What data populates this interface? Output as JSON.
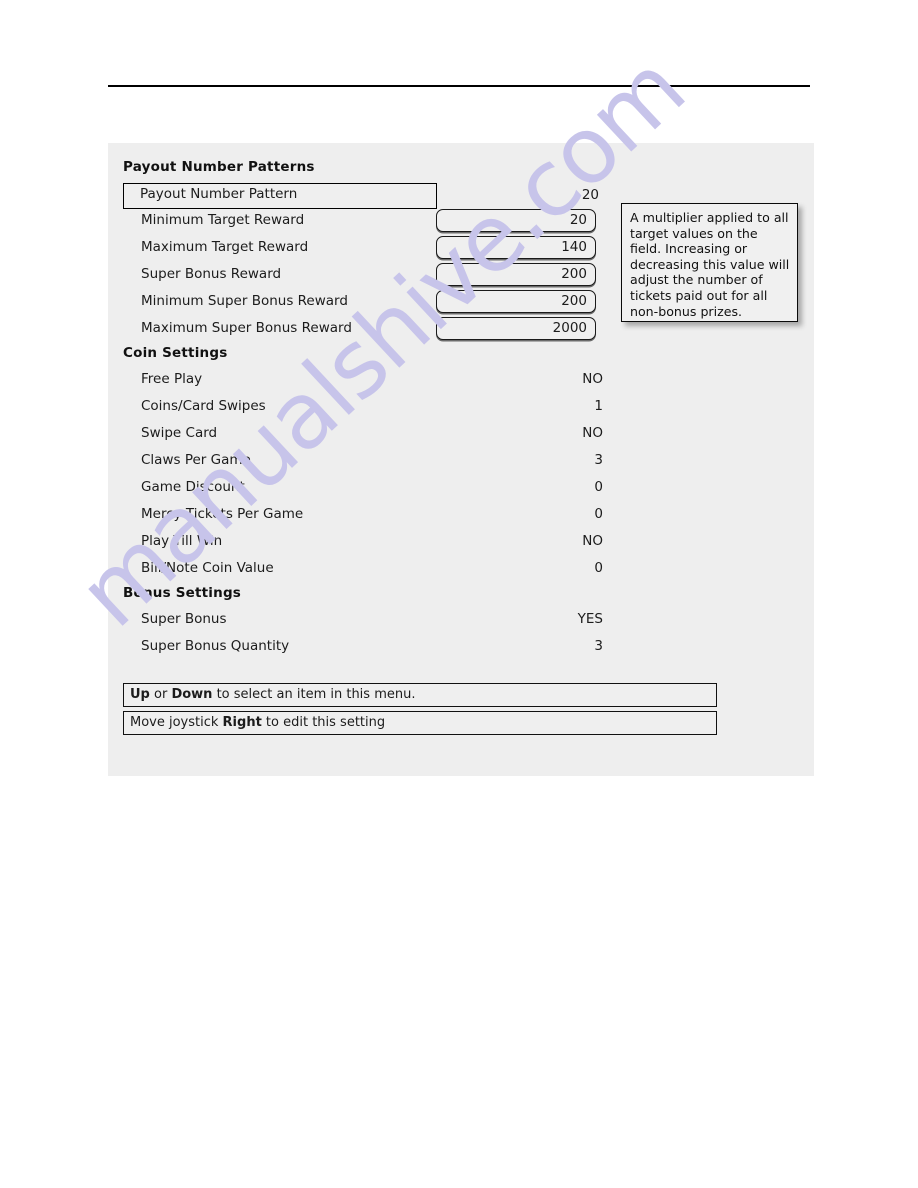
{
  "page": {
    "background": "#ffffff",
    "panel_background": "#eeeeee",
    "accent_border": "#000000",
    "watermark_text": "manualshive.com",
    "watermark_color": "#c7c4ea"
  },
  "panel": {
    "sections": [
      {
        "header": "Payout Number Patterns",
        "rows": [
          {
            "label": "Payout Number Pattern",
            "value": "20",
            "style": "selected"
          },
          {
            "label": "Minimum Target Reward",
            "value": "20",
            "style": "editbox"
          },
          {
            "label": "Maximum Target Reward",
            "value": "140",
            "style": "editbox"
          },
          {
            "label": "Super Bonus Reward",
            "value": "200",
            "style": "editbox"
          },
          {
            "label": "Minimum Super Bonus Reward",
            "value": "200",
            "style": "editbox"
          },
          {
            "label": "Maximum Super Bonus Reward",
            "value": "2000",
            "style": "editbox"
          }
        ]
      },
      {
        "header": "Coin Settings",
        "rows": [
          {
            "label": "Free Play",
            "value": "NO",
            "style": "plain"
          },
          {
            "label": "Coins/Card Swipes",
            "value": "1",
            "style": "plain"
          },
          {
            "label": "Swipe Card",
            "value": "NO",
            "style": "plain"
          },
          {
            "label": "Claws Per Game",
            "value": "3",
            "style": "plain"
          },
          {
            "label": "Game Discount",
            "value": "0",
            "style": "plain"
          },
          {
            "label": "Mercy Tickets Per Game",
            "value": "0",
            "style": "plain"
          },
          {
            "label": "Play Till Win",
            "value": "NO",
            "style": "plain"
          },
          {
            "label": "Bill/Note Coin Value",
            "value": "0",
            "style": "plain"
          }
        ]
      },
      {
        "header": "Bonus Settings",
        "rows": [
          {
            "label": "Super Bonus",
            "value": "YES",
            "style": "plain"
          },
          {
            "label": "Super Bonus Quantity",
            "value": "3",
            "style": "plain"
          }
        ]
      }
    ]
  },
  "tooltip": {
    "text": "A multiplier applied to all target values on the field. Increasing or decreasing this value will adjust the number of tickets paid out for all non-bonus prizes."
  },
  "instructions": [
    {
      "prefix": "",
      "bold1": "Up",
      "middle": " or ",
      "bold2": "Down",
      "suffix": " to select an item in this menu."
    },
    {
      "prefix": "Move joystick ",
      "bold1": "Right",
      "middle": "",
      "bold2": "",
      "suffix": " to edit this setting"
    }
  ]
}
